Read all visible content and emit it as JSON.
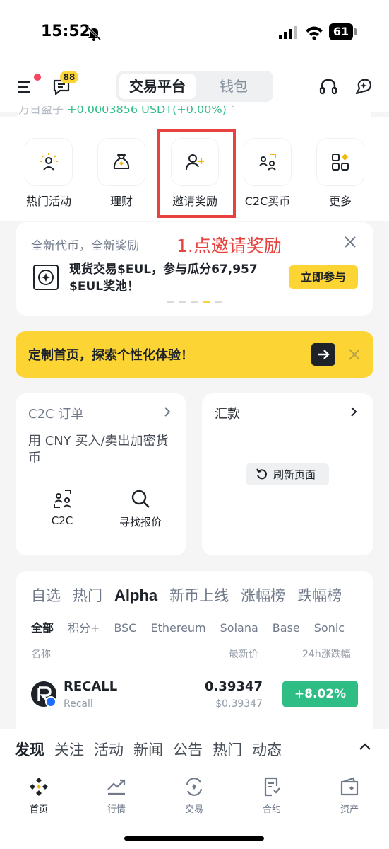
{
  "status": {
    "time": "15:52",
    "battery": "61"
  },
  "header": {
    "message_badge": "88",
    "tabs": [
      "交易平台",
      "钱包"
    ]
  },
  "balance": {
    "label": "万日盈子",
    "value": "+0.0003856 USDT(+0.00%)",
    "chevron": "˅"
  },
  "quick_actions": [
    {
      "label": "热门活动",
      "icon": "sun-person-icon"
    },
    {
      "label": "理财",
      "icon": "money-bag-icon"
    },
    {
      "label": "邀请奖励",
      "icon": "add-user-icon"
    },
    {
      "label": "C2C买币",
      "icon": "c2c-users-icon"
    },
    {
      "label": "更多",
      "icon": "grid-more-icon"
    }
  ],
  "promo": {
    "title": "全新代币，全新奖励",
    "annotation": "1.点邀请奖励",
    "text": "现货交易$EUL，参与瓜分67,957 $EUL奖池！",
    "button": "立即参与"
  },
  "banner": {
    "text": "定制首页，探索个性化体验！"
  },
  "c2c_card": {
    "title": "C2C 订单",
    "desc": "用 CNY 买入/卖出加密货币",
    "action1": "C2C",
    "action2": "寻找报价"
  },
  "remit_card": {
    "title": "汇款",
    "refresh": "刷新页面"
  },
  "market": {
    "tabs": [
      "自选",
      "热门",
      "Alpha",
      "新币上线",
      "涨幅榜",
      "跌幅榜"
    ],
    "active_tab": "Alpha",
    "subtabs": [
      "全部",
      "积分+",
      "BSC",
      "Ethereum",
      "Solana",
      "Base",
      "Sonic"
    ],
    "active_subtab": "全部",
    "columns": {
      "name": "名称",
      "price": "最新价",
      "change": "24h涨跌幅"
    },
    "rows": [
      {
        "symbol": "RECALL",
        "name": "Recall",
        "price": "0.39347",
        "usd": "$0.39347",
        "change": "+8.02%"
      }
    ]
  },
  "discover": {
    "tabs": [
      "发现",
      "关注",
      "活动",
      "新闻",
      "公告",
      "热门",
      "动态"
    ],
    "active": "发现"
  },
  "bottom_nav": [
    {
      "label": "首页",
      "icon": "home-icon"
    },
    {
      "label": "行情",
      "icon": "markets-icon"
    },
    {
      "label": "交易",
      "icon": "trade-icon"
    },
    {
      "label": "合约",
      "icon": "futures-icon"
    },
    {
      "label": "资产",
      "icon": "wallet-icon"
    }
  ],
  "colors": {
    "accent": "#fcd535",
    "positive": "#2ebd85",
    "annotation": "#e8423f"
  }
}
